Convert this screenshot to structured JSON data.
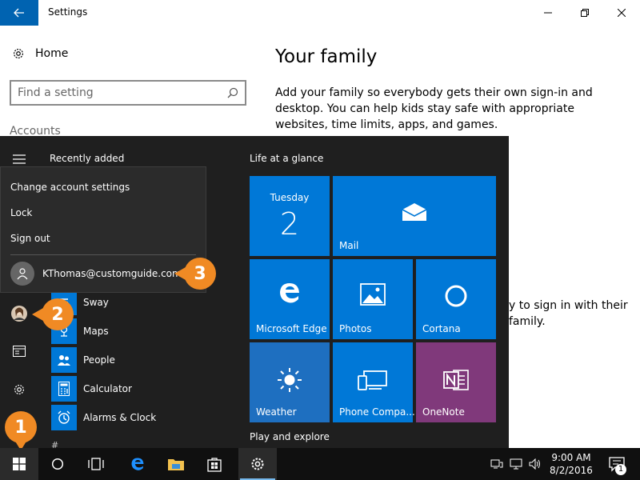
{
  "window": {
    "title": "Settings",
    "home_label": "Home",
    "search_placeholder": "Find a setting",
    "section_label": "Accounts"
  },
  "content": {
    "heading": "Your family",
    "description": "Add your family so everybody gets their own sign-in and desktop. You can help kids stay safe with appropriate websites, time limits, apps, and games.",
    "partial_line_1": "y to sign in with their",
    "partial_line_2": "family."
  },
  "start_menu": {
    "recently_added": "Recently added",
    "apps": [
      {
        "label": "Sway",
        "icon": "sway-icon"
      },
      {
        "label": "Maps",
        "icon": "maps-icon"
      },
      {
        "label": "People",
        "icon": "people-icon"
      },
      {
        "label": "Calculator",
        "icon": "calculator-icon"
      },
      {
        "label": "Alarms & Clock",
        "icon": "alarm-clock-icon"
      }
    ],
    "section_hash": "#",
    "life_at_a_glance": "Life at a glance",
    "play_and_explore": "Play and explore",
    "tiles": {
      "calendar_day": "Tuesday",
      "calendar_date": "2",
      "mail": "Mail",
      "edge": "Microsoft Edge",
      "photos": "Photos",
      "cortana": "Cortana",
      "weather": "Weather",
      "phone": "Phone Compa...",
      "onenote": "OneNote"
    },
    "colors": {
      "tile_blue": "#0078d7",
      "weather_blue": "#1e6fc0",
      "onenote_purple": "#80397b"
    }
  },
  "account_flyout": {
    "change_settings": "Change account settings",
    "lock": "Lock",
    "sign_out": "Sign out",
    "user_email": "KThomas@customguide.com"
  },
  "callouts": {
    "step1": "1",
    "step2": "2",
    "step3": "3"
  },
  "taskbar": {
    "time": "9:00 AM",
    "date": "8/2/2016",
    "notification_count": "1"
  }
}
